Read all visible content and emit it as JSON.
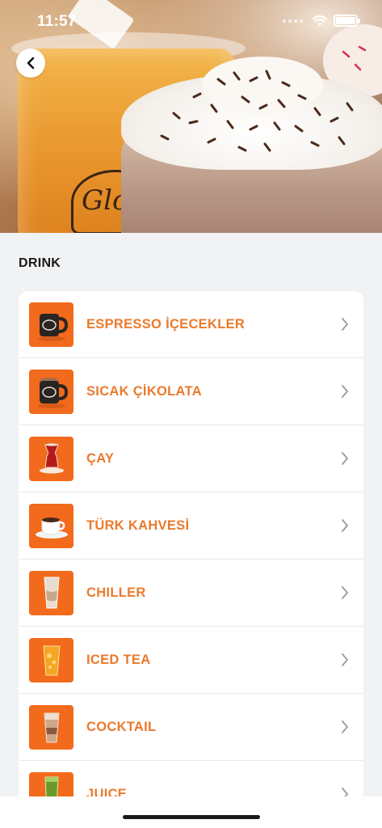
{
  "status_bar": {
    "time": "11:57"
  },
  "section": {
    "title": "DRINK"
  },
  "hero": {
    "logo_text": "Glor"
  },
  "categories": [
    {
      "label": "ESPRESSO İÇECEKLER",
      "icon": "espresso-mug-icon"
    },
    {
      "label": "SICAK ÇİKOLATA",
      "icon": "hot-chocolate-mug-icon"
    },
    {
      "label": "ÇAY",
      "icon": "tea-glass-icon"
    },
    {
      "label": "TÜRK KAHVESİ",
      "icon": "turkish-coffee-cup-icon"
    },
    {
      "label": "CHILLER",
      "icon": "chiller-cup-icon"
    },
    {
      "label": "ICED TEA",
      "icon": "iced-tea-cup-icon"
    },
    {
      "label": "COCKTAIL",
      "icon": "cocktail-cup-icon"
    },
    {
      "label": "JUICE",
      "icon": "juice-cup-icon"
    }
  ],
  "colors": {
    "accent": "#ea7a2c",
    "thumb_bg": "#f26a1b",
    "page_bg": "#f1f2f4"
  }
}
